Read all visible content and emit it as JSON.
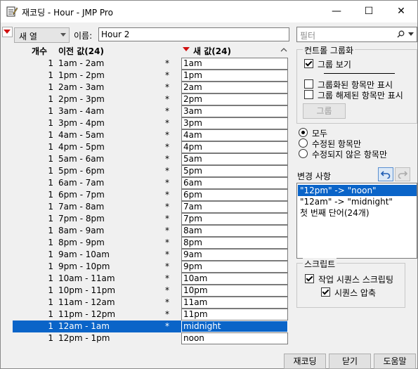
{
  "title": "재코딩 - Hour - JMP Pro",
  "window_controls": {
    "minimize": "—",
    "maximize": "☐",
    "close": "✕"
  },
  "toolbar": {
    "column_mode": "새 열",
    "name_label": "이름:",
    "name_value": "Hour 2",
    "filter_placeholder": "필터"
  },
  "table": {
    "col_count": "개수",
    "col_old": "이전 값(24)",
    "col_new": "새 값(24)",
    "rows": [
      {
        "count": "1",
        "old": "1am - 2am",
        "star": "*",
        "new": "1am"
      },
      {
        "count": "1",
        "old": "1pm - 2pm",
        "star": "*",
        "new": "1pm"
      },
      {
        "count": "1",
        "old": "2am - 3am",
        "star": "*",
        "new": "2am"
      },
      {
        "count": "1",
        "old": "2pm - 3pm",
        "star": "*",
        "new": "2pm"
      },
      {
        "count": "1",
        "old": "3am - 4am",
        "star": "*",
        "new": "3am"
      },
      {
        "count": "1",
        "old": "3pm - 4pm",
        "star": "*",
        "new": "3pm"
      },
      {
        "count": "1",
        "old": "4am - 5am",
        "star": "*",
        "new": "4am"
      },
      {
        "count": "1",
        "old": "4pm - 5pm",
        "star": "*",
        "new": "4pm"
      },
      {
        "count": "1",
        "old": "5am - 6am",
        "star": "*",
        "new": "5am"
      },
      {
        "count": "1",
        "old": "5pm - 6pm",
        "star": "*",
        "new": "5pm"
      },
      {
        "count": "1",
        "old": "6am - 7am",
        "star": "*",
        "new": "6am"
      },
      {
        "count": "1",
        "old": "6pm - 7pm",
        "star": "*",
        "new": "6pm"
      },
      {
        "count": "1",
        "old": "7am - 8am",
        "star": "*",
        "new": "7am"
      },
      {
        "count": "1",
        "old": "7pm - 8pm",
        "star": "*",
        "new": "7pm"
      },
      {
        "count": "1",
        "old": "8am - 9am",
        "star": "*",
        "new": "8am"
      },
      {
        "count": "1",
        "old": "8pm - 9pm",
        "star": "*",
        "new": "8pm"
      },
      {
        "count": "1",
        "old": "9am - 10am",
        "star": "*",
        "new": "9am"
      },
      {
        "count": "1",
        "old": "9pm - 10pm",
        "star": "*",
        "new": "9pm"
      },
      {
        "count": "1",
        "old": "10am - 11am",
        "star": "*",
        "new": "10am"
      },
      {
        "count": "1",
        "old": "10pm - 11pm",
        "star": "*",
        "new": "10pm"
      },
      {
        "count": "1",
        "old": "11am - 12am",
        "star": "*",
        "new": "11am"
      },
      {
        "count": "1",
        "old": "11pm - 12pm",
        "star": "*",
        "new": "11pm"
      },
      {
        "count": "1",
        "old": "12am - 1am",
        "star": "*",
        "new": "midnight",
        "selected": true
      },
      {
        "count": "1",
        "old": "12pm - 1pm",
        "star": "",
        "new": "noon"
      }
    ]
  },
  "control_grouping": {
    "title": "컨트롤 그룹화",
    "show_groups": "그룹 보기",
    "show_grouped_only": "그룹화된 항목만 표시",
    "show_ungrouped_only": "그룹 해제된 항목만 표시",
    "group_button": "그룹"
  },
  "view_filter": {
    "all": "모두",
    "modified_only": "수정된 항목만",
    "unmodified_only": "수정되지 않은 항목만"
  },
  "changes": {
    "title": "변경 사항",
    "items": [
      "\"12pm\" -> \"noon\"",
      "\"12am\" -> \"midnight\"",
      "첫 번째 단어(24개)"
    ]
  },
  "script": {
    "title": "스크립트",
    "workflow": "작업 시퀀스 스크립팅",
    "compress": "시퀀스 압축"
  },
  "buttons": {
    "recode": "재코딩",
    "close": "닫기",
    "help": "도움말"
  }
}
